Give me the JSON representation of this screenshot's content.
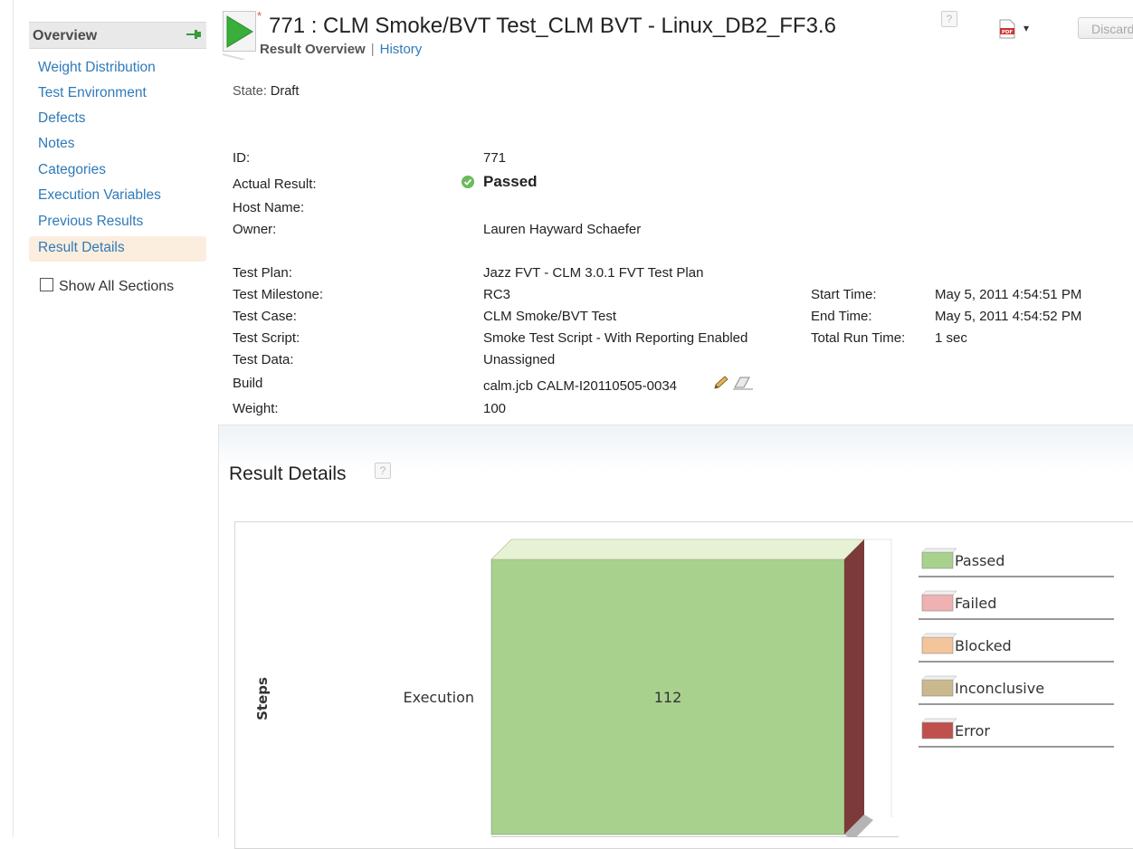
{
  "nav": {
    "header": "Overview",
    "items": [
      {
        "label": "Weight Distribution"
      },
      {
        "label": "Test Environment"
      },
      {
        "label": "Defects"
      },
      {
        "label": "Notes"
      },
      {
        "label": "Categories"
      },
      {
        "label": "Execution Variables"
      },
      {
        "label": "Previous Results"
      },
      {
        "label": "Result Details",
        "selected": true
      }
    ],
    "show_all_label": "Show All Sections"
  },
  "header": {
    "dirty_marker": "*",
    "title": "771 :  CLM Smoke/BVT Test_CLM BVT - Linux_DB2_FF3.6",
    "discard_label": "Discard",
    "tabs": [
      "Result Overview",
      "History"
    ],
    "separator": "|"
  },
  "state": {
    "label": "State:",
    "value": "Draft"
  },
  "fields": {
    "id": {
      "label": "ID:",
      "value": "771"
    },
    "actual_result": {
      "label": "Actual Result:",
      "value": "Passed"
    },
    "host_name": {
      "label": "Host Name:",
      "value": ""
    },
    "owner": {
      "label": "Owner:",
      "value": "Lauren Hayward Schaefer"
    },
    "test_plan": {
      "label": "Test Plan:",
      "value": "Jazz FVT - CLM 3.0.1 FVT Test Plan"
    },
    "test_milestone": {
      "label": "Test Milestone:",
      "value": "RC3"
    },
    "test_case": {
      "label": "Test Case:",
      "value": "CLM Smoke/BVT Test"
    },
    "test_script": {
      "label": "Test Script:",
      "value": "Smoke Test Script - With Reporting Enabled"
    },
    "test_data": {
      "label": "Test Data:",
      "value": "Unassigned"
    },
    "build": {
      "label": "Build",
      "value": "calm.jcb CALM-I20110505-0034"
    },
    "weight": {
      "label": "Weight:",
      "value": "100"
    },
    "start_time": {
      "label": "Start Time:",
      "value": "May 5, 2011 4:54:51 PM"
    },
    "end_time": {
      "label": "End Time:",
      "value": "May 5, 2011 4:54:52 PM"
    },
    "total_run_time": {
      "label": "Total Run Time:",
      "value": "1 sec"
    }
  },
  "result_details": {
    "title": "Result Details"
  },
  "help_glyph": "?",
  "pdf_caret": "▾",
  "colors": {
    "link": "#2f7ab9",
    "passed": "#a9d18e",
    "selected_nav": "#fbeede"
  },
  "chart_data": {
    "type": "bar",
    "ylabel": "Steps",
    "categories": [
      "Execution"
    ],
    "series": [
      {
        "name": "Passed",
        "values": [
          112
        ],
        "color": "#a9d18e"
      },
      {
        "name": "Failed",
        "values": [
          0
        ],
        "color": "#efb1b1"
      },
      {
        "name": "Blocked",
        "values": [
          0
        ],
        "color": "#f4c49a"
      },
      {
        "name": "Inconclusive",
        "values": [
          0
        ],
        "color": "#c9b98c"
      },
      {
        "name": "Error",
        "values": [
          0
        ],
        "color": "#c0504d"
      }
    ],
    "data_labels": [
      "112"
    ],
    "legend_position": "right"
  }
}
